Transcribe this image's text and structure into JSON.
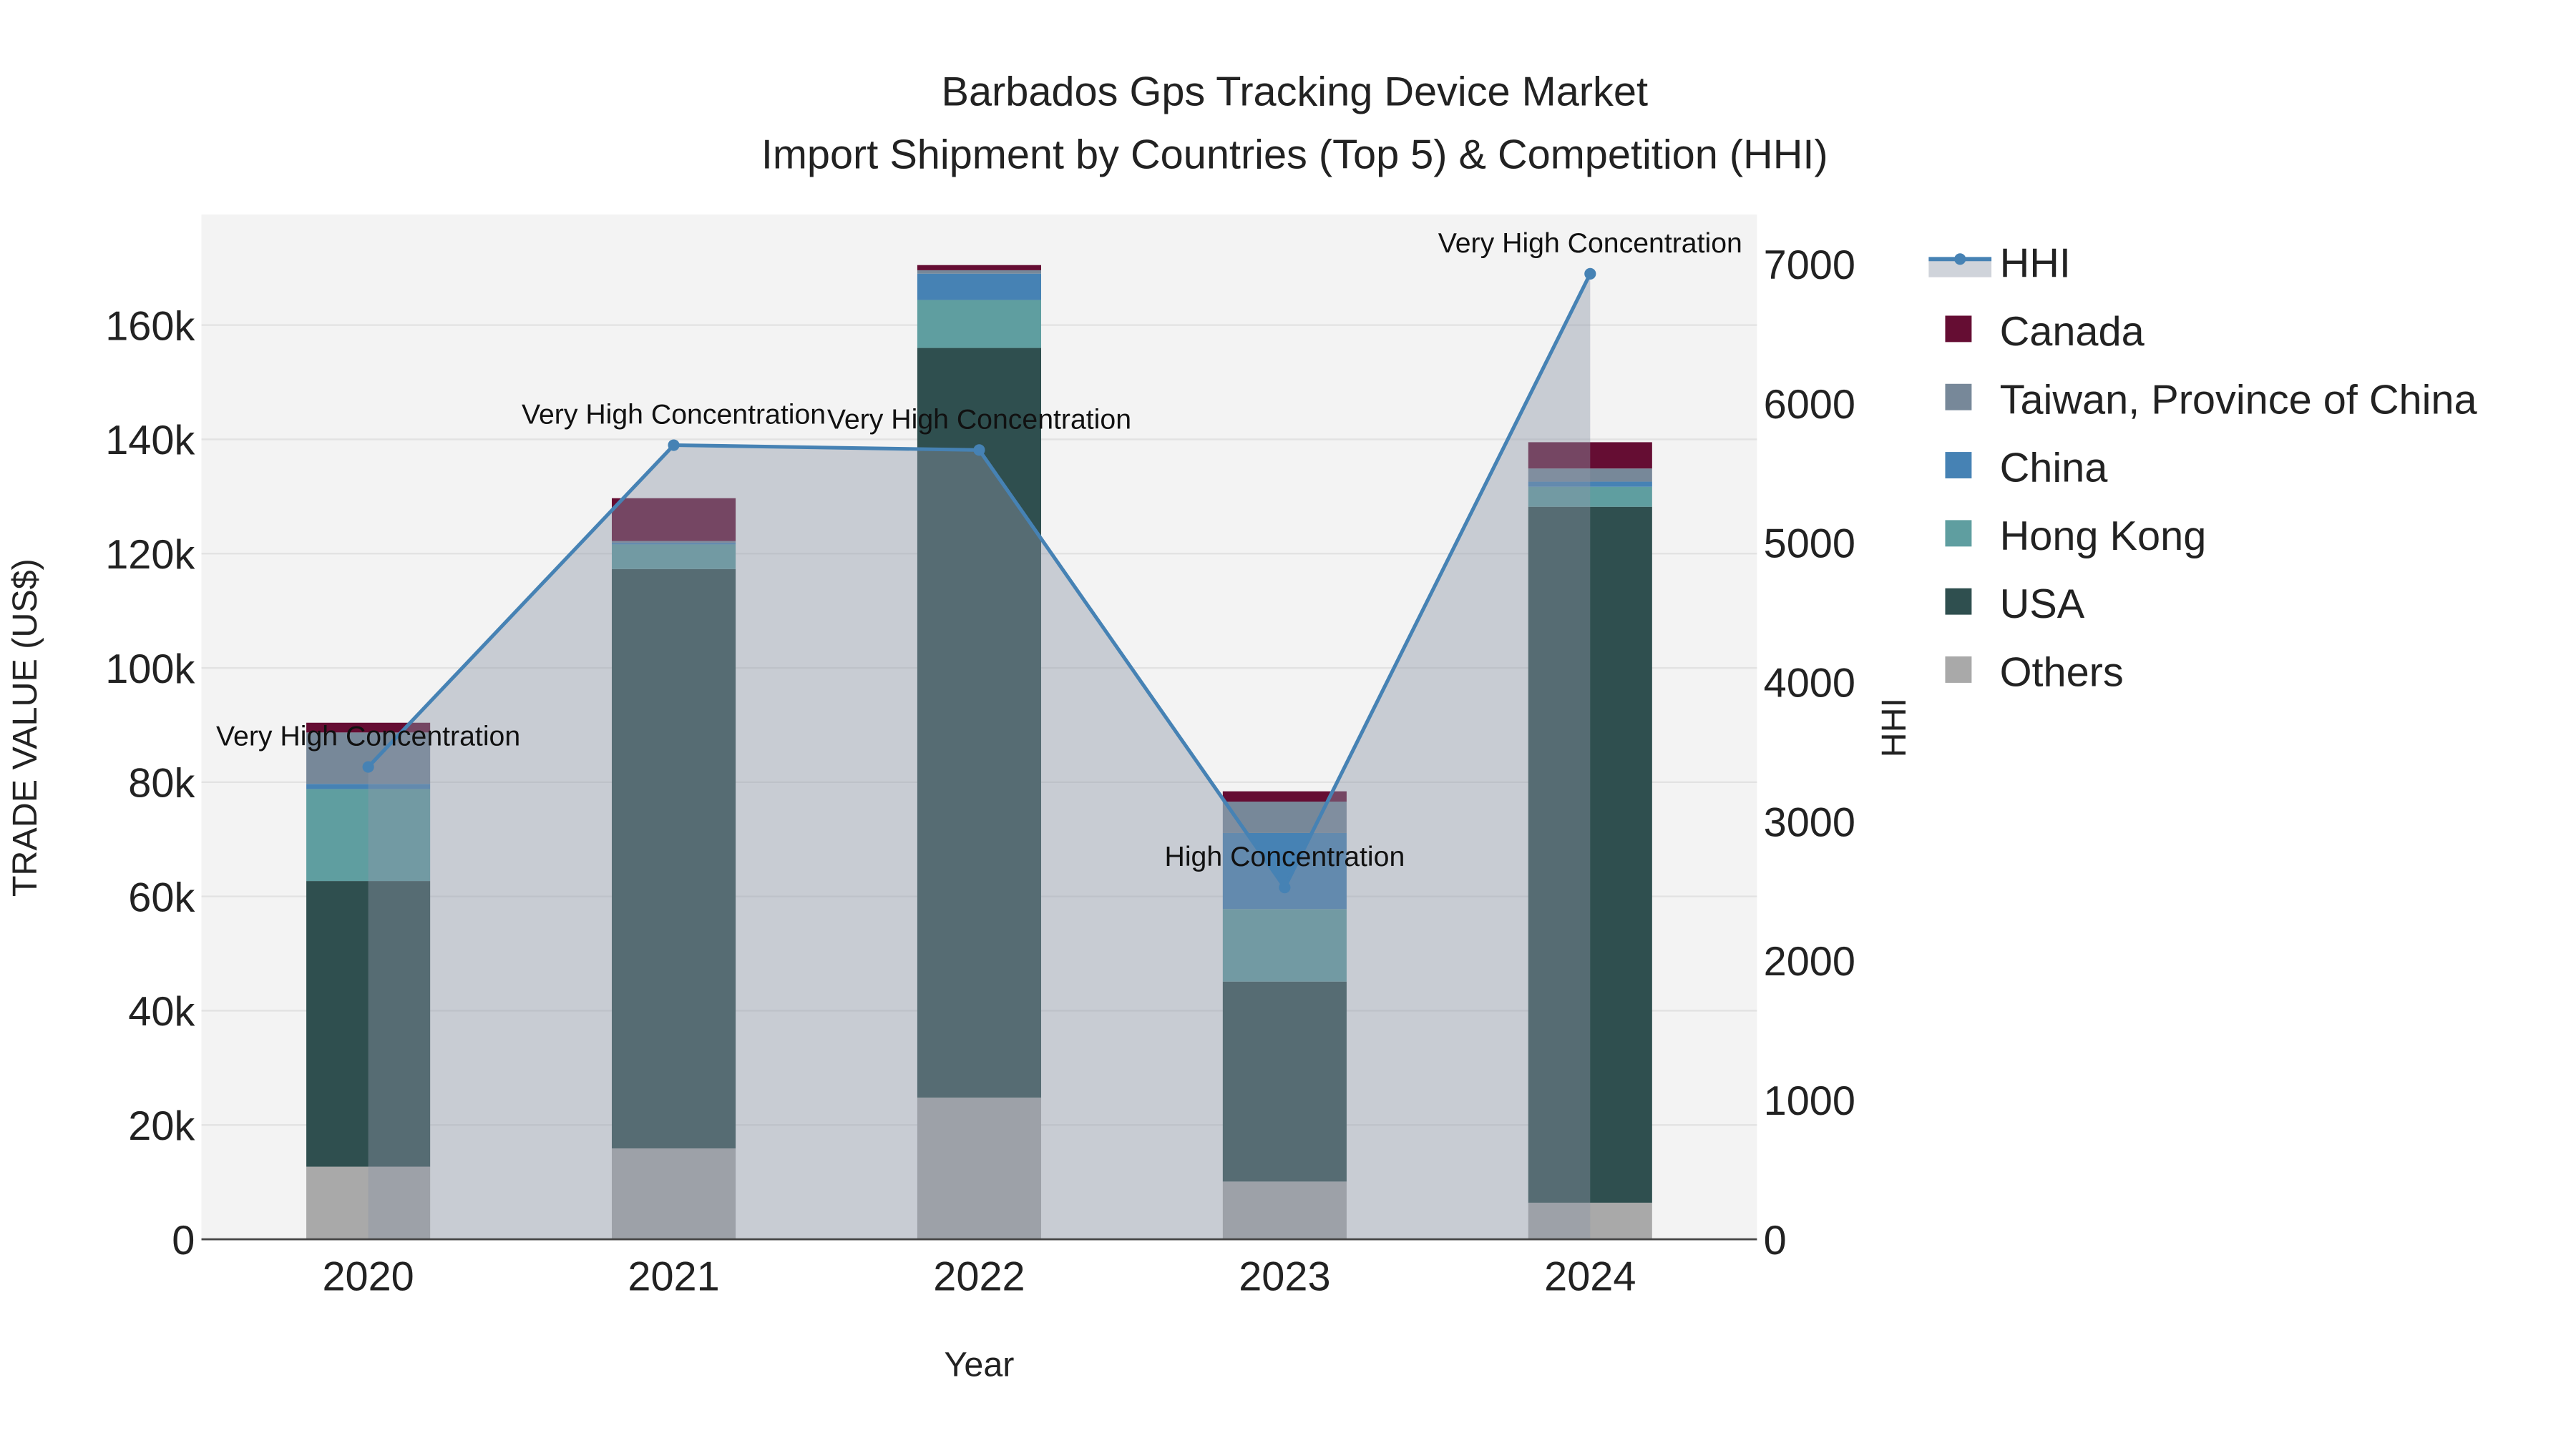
{
  "chart_data": {
    "type": "bar",
    "title": "Barbados Gps Tracking Device Market",
    "subtitle": "Import Shipment by Countries (Top 5) & Competition (HHI)",
    "xlabel": "Year",
    "ylabel": "TRADE VALUE (US$)",
    "y2label": "HHI",
    "categories": [
      "2020",
      "2021",
      "2022",
      "2023",
      "2024"
    ],
    "ylim": [
      0,
      178000
    ],
    "y_ticks": [
      0,
      20000,
      40000,
      60000,
      80000,
      100000,
      120000,
      140000,
      160000
    ],
    "y_tick_labels": [
      "0",
      "20k",
      "40k",
      "60k",
      "80k",
      "100k",
      "120k",
      "140k",
      "160k"
    ],
    "y2lim": [
      0,
      7350
    ],
    "y2_ticks": [
      0,
      1000,
      2000,
      3000,
      4000,
      5000,
      6000,
      7000
    ],
    "y2_tick_labels": [
      "0",
      "1000",
      "2000",
      "3000",
      "4000",
      "5000",
      "6000",
      "7000"
    ],
    "grid": true,
    "legend_position": "right",
    "stack_order": [
      "Others",
      "USA",
      "Hong Kong",
      "China",
      "Taiwan, Province of China",
      "Canada"
    ],
    "series": [
      {
        "name": "Canada",
        "color": "#650d33",
        "values": [
          1700,
          7500,
          900,
          1800,
          4600
        ]
      },
      {
        "name": "Taiwan, Province of China",
        "color": "#778899",
        "values": [
          9000,
          300,
          600,
          5500,
          2300
        ]
      },
      {
        "name": "China",
        "color": "#4682b4",
        "values": [
          900,
          300,
          4600,
          13300,
          900
        ]
      },
      {
        "name": "Hong Kong",
        "color": "#5f9ea0",
        "values": [
          16100,
          4300,
          8400,
          12700,
          3500
        ]
      },
      {
        "name": "USA",
        "color": "#2f4f4f",
        "values": [
          50000,
          101400,
          131200,
          35000,
          121800
        ]
      },
      {
        "name": "Others",
        "color": "#a9a9a9",
        "values": [
          12700,
          15900,
          24800,
          10100,
          6400
        ]
      }
    ],
    "hhi": {
      "name": "HHI",
      "color": "#4682b4",
      "values": [
        3390,
        5700,
        5665,
        2525,
        6930
      ],
      "annotations": [
        "Very High Concentration",
        "Very High Concentration",
        "Very High Concentration",
        "High Concentration",
        "Very High Concentration"
      ]
    }
  }
}
